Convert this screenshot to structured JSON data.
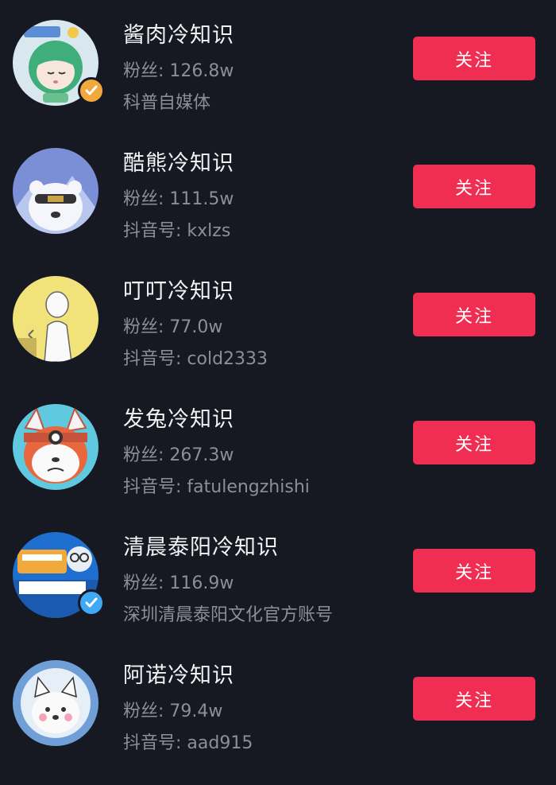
{
  "accounts": [
    {
      "name": "酱肉冷知识",
      "fans": "粉丝: 126.8w",
      "desc": "科普自媒体",
      "follow_label": "关注",
      "verified": "gold",
      "avatar": "bangs-girl-avatar"
    },
    {
      "name": "酷熊冷知识",
      "fans": "粉丝: 111.5w",
      "desc": "抖音号: kxlzs",
      "follow_label": "关注",
      "verified": "none",
      "avatar": "polar-bear-avatar"
    },
    {
      "name": "叮叮冷知识",
      "fans": "粉丝: 77.0w",
      "desc": "抖音号: cold2333",
      "follow_label": "关注",
      "verified": "none",
      "avatar": "doodle-figure-avatar"
    },
    {
      "name": "发兔冷知识",
      "fans": "粉丝: 267.3w",
      "desc": "抖音号: fatulengzhishi",
      "follow_label": "关注",
      "verified": "none",
      "avatar": "dog-headband-avatar"
    },
    {
      "name": "清晨泰阳冷知识",
      "fans": "粉丝: 116.9w",
      "desc": "深圳清晨泰阳文化官方账号",
      "follow_label": "关注",
      "verified": "blue",
      "avatar": "body-facts-logo-avatar"
    },
    {
      "name": "阿诺冷知识",
      "fans": "粉丝: 79.4w",
      "desc": "抖音号: aad915",
      "follow_label": "关注",
      "verified": "none",
      "avatar": "white-dog-avatar"
    }
  ],
  "colors": {
    "background": "#161822",
    "follow_button": "#f02d52",
    "name_text": "#f2f2f4",
    "secondary_text": "#8d8e96",
    "badge_gold": "#f2a93b",
    "badge_blue": "#3fa9f5"
  }
}
